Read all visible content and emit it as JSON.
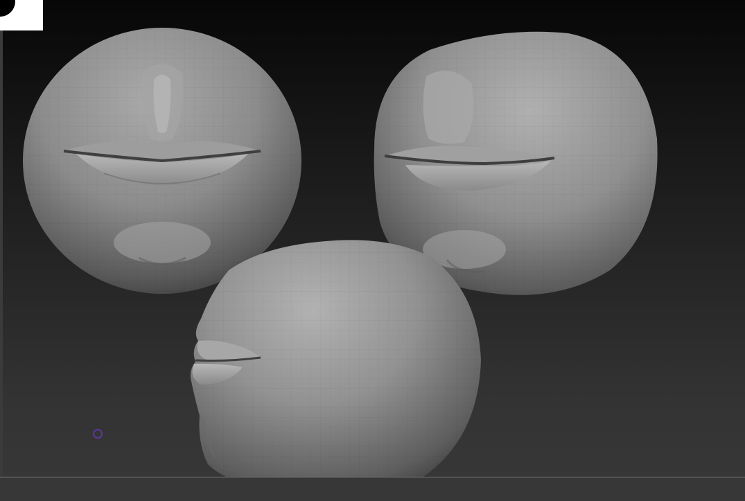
{
  "viewport": {
    "background_top": "#070707",
    "background_bottom": "#383838",
    "floor_line_color": "#7b7b7b"
  },
  "models": [
    {
      "name": "mouth-sphere-front",
      "view": "front",
      "base_color": "#8f8f8f"
    },
    {
      "name": "mouth-sphere-three-quarter",
      "view": "three-quarter",
      "base_color": "#8f8f8f"
    },
    {
      "name": "mouth-sphere-side",
      "view": "side",
      "base_color": "#8f8f8f"
    }
  ],
  "cursor": {
    "icon": "brush-cursor-icon",
    "color": "#5d37a0"
  },
  "corner_widget": {
    "icon": "navigation-orb-icon"
  }
}
